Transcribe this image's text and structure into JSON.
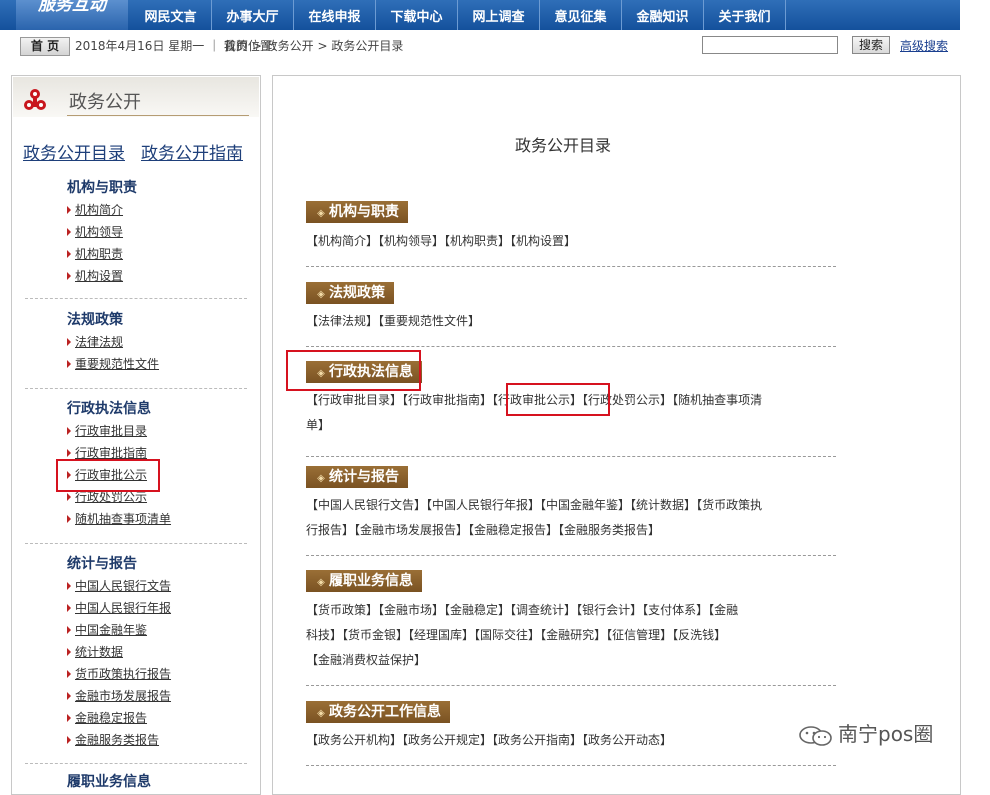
{
  "brand": "服务互动",
  "nav": [
    "网民文言",
    "办事大厅",
    "在线申报",
    "下载中心",
    "网上调查",
    "意见征集",
    "金融知识",
    "关于我们"
  ],
  "infobar": {
    "home": "首 页",
    "date": "2018年4月16日 星期一 ｜ 我的位置:",
    "breadcrumb": "首页 > 政务公开 > 政务公开目录",
    "search_button": "搜索",
    "advanced_search": "高级搜索"
  },
  "sidebar": {
    "title": "政务公开",
    "links": [
      "政务公开目录",
      "政务公开指南"
    ],
    "sections": [
      {
        "title": "机构与职责",
        "items": [
          "机构简介",
          "机构领导",
          "机构职责",
          "机构设置"
        ]
      },
      {
        "title": "法规政策",
        "items": [
          "法律法规",
          "重要规范性文件"
        ]
      },
      {
        "title": "行政执法信息",
        "items": [
          "行政审批目录",
          "行政审批指南",
          "行政审批公示",
          "行政处罚公示",
          "随机抽查事项清单"
        ]
      },
      {
        "title": "统计与报告",
        "items": [
          "中国人民银行文告",
          "中国人民银行年报",
          "中国金融年鉴",
          "统计数据",
          "货币政策执行报告",
          "金融市场发展报告",
          "金融稳定报告",
          "金融服务类报告"
        ]
      },
      {
        "title": "履职业务信息",
        "items": []
      }
    ]
  },
  "main": {
    "title": "政务公开目录",
    "categories": [
      {
        "title": "机构与职责",
        "links": [
          "【机构简介】",
          "【机构领导】",
          "【机构职责】",
          "【机构设置】"
        ]
      },
      {
        "title": "法规政策",
        "links": [
          "【法律法规】",
          "【重要规范性文件】"
        ]
      },
      {
        "title": "行政执法信息",
        "links": [
          "【行政审批目录】",
          "【行政审批指南】",
          "【行政审批公示】",
          "【行政处罚公示】",
          "【随机抽查事项清单】"
        ]
      },
      {
        "title": "统计与报告",
        "links": [
          "【中国人民银行文告】",
          "【中国人民银行年报】",
          "【中国金融年鉴】",
          "【统计数据】",
          "【货币政策执行报告】",
          "【金融市场发展报告】",
          "【金融稳定报告】",
          "【金融服务类报告】"
        ]
      },
      {
        "title": "履职业务信息",
        "links": [
          "【货币政策】",
          "【金融市场】",
          "【金融稳定】",
          "【调查统计】",
          "【银行会计】",
          "【支付体系】",
          "【金融科技】",
          "【货币金银】",
          "【经理国库】",
          "【国际交往】",
          "【金融研究】",
          "【征信管理】",
          "【反洗钱】",
          "【金融消费权益保护】"
        ]
      },
      {
        "title": "政务公开工作信息",
        "links": [
          "【政务公开机构】",
          "【政务公开规定】",
          "【政务公开指南】",
          "【政务公开动态】"
        ]
      }
    ]
  },
  "watermark": "南宁pos圈",
  "colors": {
    "nav": "#14519c",
    "badge": "#8a6230",
    "highlight": "#d6121f"
  }
}
